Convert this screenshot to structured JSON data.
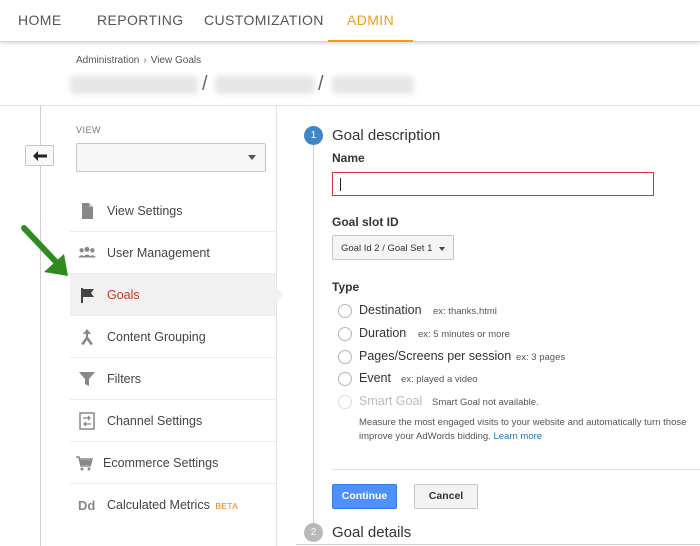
{
  "nav": {
    "tabs": [
      "HOME",
      "REPORTING",
      "CUSTOMIZATION",
      "ADMIN"
    ],
    "active": "ADMIN",
    "accent_color": "#f39c12"
  },
  "breadcrumb": {
    "root": "Administration",
    "separator": "›",
    "current": "View Goals"
  },
  "account_path": {
    "separator": "/"
  },
  "sidebar": {
    "back_glyph": "🡐",
    "view_label": "VIEW",
    "view_selected": "",
    "items": [
      {
        "label": "View Settings",
        "icon": "document-icon"
      },
      {
        "label": "User Management",
        "icon": "users-icon"
      },
      {
        "label": "Goals",
        "icon": "flag-icon",
        "active": true
      },
      {
        "label": "Content Grouping",
        "icon": "content-grouping-icon"
      },
      {
        "label": "Filters",
        "icon": "filter-icon"
      },
      {
        "label": "Channel Settings",
        "icon": "channel-icon"
      },
      {
        "label": "Ecommerce Settings",
        "icon": "cart-icon"
      },
      {
        "label": "Calculated Metrics",
        "icon": "dd-icon",
        "badge": "BETA"
      }
    ]
  },
  "goal_form": {
    "step1": {
      "number": "1",
      "title": "Goal description"
    },
    "name_label": "Name",
    "name_value": "",
    "slot_label": "Goal slot ID",
    "slot_value": "Goal Id 2 / Goal Set 1",
    "type_label": "Type",
    "types": [
      {
        "label": "Destination",
        "example": "ex: thanks.html"
      },
      {
        "label": "Duration",
        "example": "ex: 5 minutes or more"
      },
      {
        "label": "Pages/Screens per session",
        "example": "ex: 3 pages"
      },
      {
        "label": "Event",
        "example": "ex: played a video"
      },
      {
        "label": "Smart Goal",
        "example": "Smart Goal not available.",
        "disabled": true
      }
    ],
    "smart_desc_line1": "Measure the most engaged visits to your website and automatically turn those",
    "smart_desc_line2": "improve your AdWords bidding.",
    "learn_more": "Learn more",
    "continue_label": "Continue",
    "cancel_label": "Cancel",
    "step2": {
      "number": "2",
      "title": "Goal details"
    },
    "error_color": "#dd3333",
    "primary_color": "#4d90fe",
    "active_item_color": "#c0392b"
  },
  "annotation_arrow_color": "#2e8b1e"
}
